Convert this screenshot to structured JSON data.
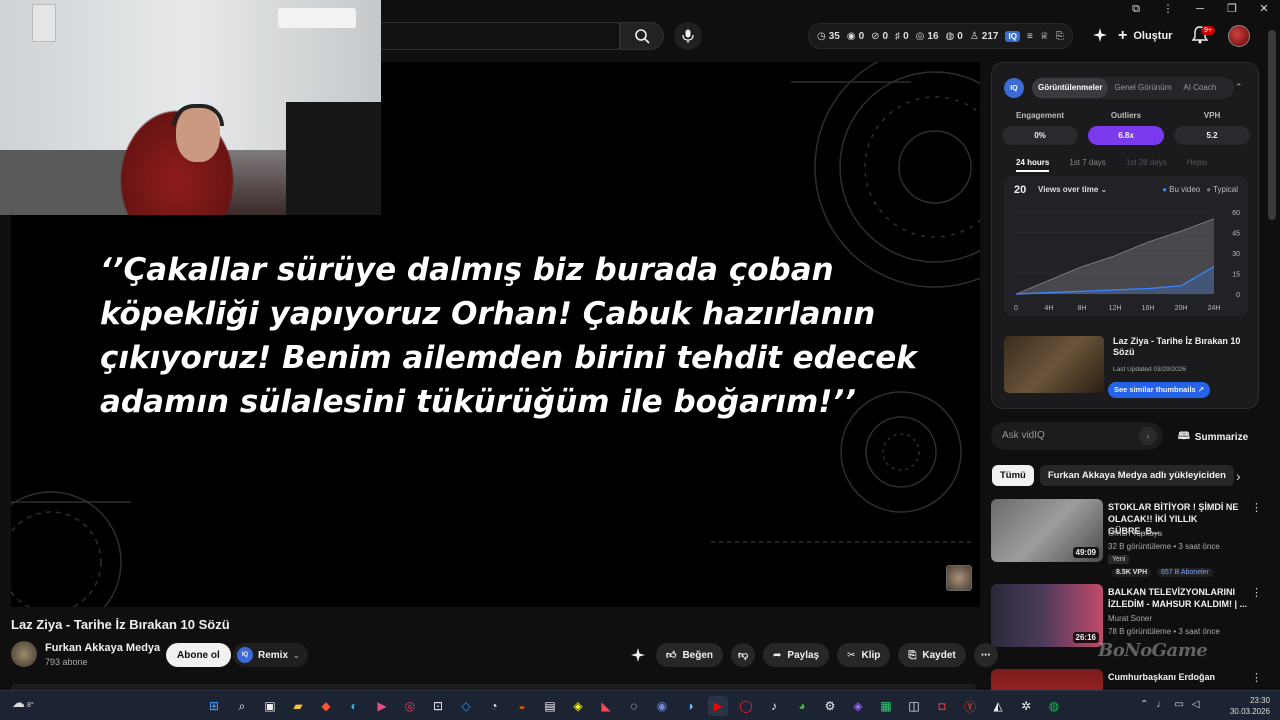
{
  "search": {
    "placeholder": ""
  },
  "stats": [
    {
      "icon": "clock-icon",
      "value": "35"
    },
    {
      "icon": "eye-icon",
      "value": "0"
    },
    {
      "icon": "eye-off-icon",
      "value": "0"
    },
    {
      "icon": "tag-icon",
      "value": "0"
    },
    {
      "icon": "check-circle-icon",
      "value": "16"
    },
    {
      "icon": "circle-icon",
      "value": "0"
    },
    {
      "icon": "person-icon",
      "value": "217"
    }
  ],
  "stats_badge": "IQ",
  "header": {
    "create_label": "Oluştur",
    "notifications": "9+"
  },
  "video": {
    "quote": "‘’Çakallar sürüye dalmış biz burada çoban köpekliği yapıyoruz Orhan! Çabuk hazırlanın çıkıyoruz! Benim ailemden birini tehdit edecek adamın sülalesini tükürüğüm ile boğarım!’’",
    "title": "Laz Ziya - Tarihe İz Bırakan 10 Sözü",
    "channel": "Furkan Akkaya Medya",
    "subscribers": "793 abone",
    "subscribe_label": "Abone ol",
    "remix_label": "Remix",
    "remix_badge": "IQ",
    "actions": {
      "like": "Beğen",
      "share": "Paylaş",
      "clip": "Klip",
      "save": "Kaydet"
    }
  },
  "vidiq": {
    "logo": "IQ",
    "tabs": [
      "Görüntülenmeler",
      "Genel Görünüm",
      "AI Coach"
    ],
    "metrics": [
      {
        "label": "Engagement",
        "value": "0%"
      },
      {
        "label": "Outliers",
        "value": "6.8x"
      },
      {
        "label": "VPH",
        "value": "5.2"
      }
    ],
    "ranges": [
      "24 hours",
      "1st 7 days",
      "1st 28 days",
      "Hepsi"
    ],
    "chart_header_value": "20",
    "chart_selector": "Views over time",
    "legend": [
      "Bu video",
      "Typical"
    ],
    "thumb_title": "Laz Ziya - Tarihe İz Bırakan 10 Sözü",
    "last_updated": "Last Updated 03/29/2026",
    "similar_label": "See similar thumbnails ↗",
    "ask_placeholder": "Ask vidIQ",
    "summarize_label": "Summarize"
  },
  "chart_data": {
    "type": "area",
    "x": [
      "0",
      "4H",
      "8H",
      "12H",
      "16H",
      "20H",
      "24H"
    ],
    "y_ticks": [
      "0",
      "15",
      "30",
      "45",
      "60"
    ],
    "ylim": [
      0,
      60
    ],
    "series": [
      {
        "name": "Bu video",
        "values": [
          0,
          1,
          2,
          3,
          4,
          6,
          20
        ]
      },
      {
        "name": "Typical",
        "values": [
          0,
          10,
          20,
          28,
          38,
          46,
          55
        ]
      }
    ]
  },
  "chips": [
    "Tümü",
    "Furkan Akkaya Medya adlı yükleyiciden"
  ],
  "recommendations": [
    {
      "title": "STOKLAR BİTİYOR ! ŞİMDİ NE OLACAK!! İKİ YILLIK GÜBRE..B...",
      "channel": "Orhun Topkaya",
      "meta": "32 B görüntüleme • 3 saat önce",
      "badge": "Yeni",
      "vph": "8.5K VPH",
      "subs": "657 B Aboneler",
      "duration": "49:09"
    },
    {
      "title": "BALKAN TELEVİZYONLARINI İZLEDİM - MAHSUR KALDIM! | ...",
      "channel": "Murat Soner",
      "meta": "78 B görüntüleme • 3 saat önce",
      "duration": "26:16"
    },
    {
      "title": "Cumhurbaşkanı Erdoğan",
      "channel": "",
      "meta": ""
    }
  ],
  "watermark": "BoNoGame",
  "taskbar": {
    "weather": "8°",
    "time": "23:30",
    "date": "30.03.2026"
  }
}
